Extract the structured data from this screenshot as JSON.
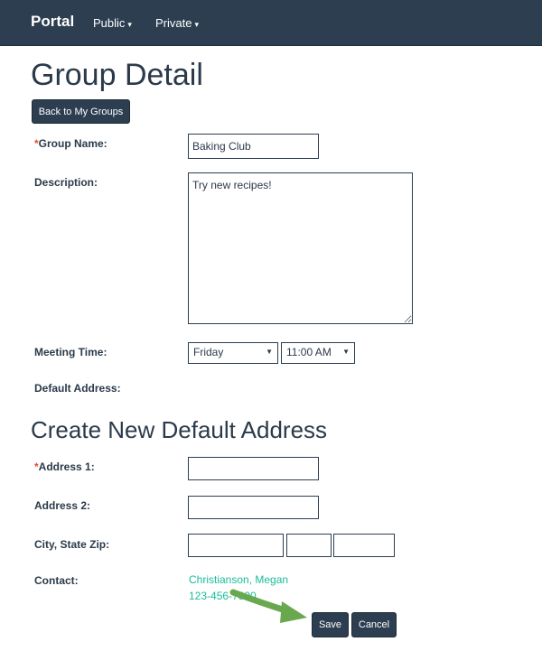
{
  "navbar": {
    "brand": "Portal",
    "items": [
      {
        "label": "Public"
      },
      {
        "label": "Private"
      }
    ]
  },
  "page": {
    "title": "Group Detail",
    "back_button": "Back to My Groups"
  },
  "form": {
    "group_name": {
      "label": "Group Name:",
      "value": "Baking Club"
    },
    "description": {
      "label": "Description:",
      "value": "Try new recipes!"
    },
    "meeting_time": {
      "label": "Meeting Time:",
      "day": "Friday",
      "time": "11:00 AM"
    },
    "default_address": {
      "label": "Default Address:"
    }
  },
  "new_address": {
    "title": "Create New Default Address",
    "address1": {
      "label": "Address 1:",
      "value": ""
    },
    "address2": {
      "label": "Address 2:",
      "value": ""
    },
    "city_state_zip": {
      "label": "City, State Zip:"
    },
    "contact": {
      "label": "Contact:",
      "name": "Christianson, Megan",
      "phone": "123-456-7890"
    }
  },
  "actions": {
    "save": "Save",
    "cancel": "Cancel"
  },
  "colors": {
    "navbar": "#2c3e50",
    "accent_link": "#1abc9c",
    "required": "#e74c3c",
    "annotation_arrow": "#6aa84f"
  }
}
